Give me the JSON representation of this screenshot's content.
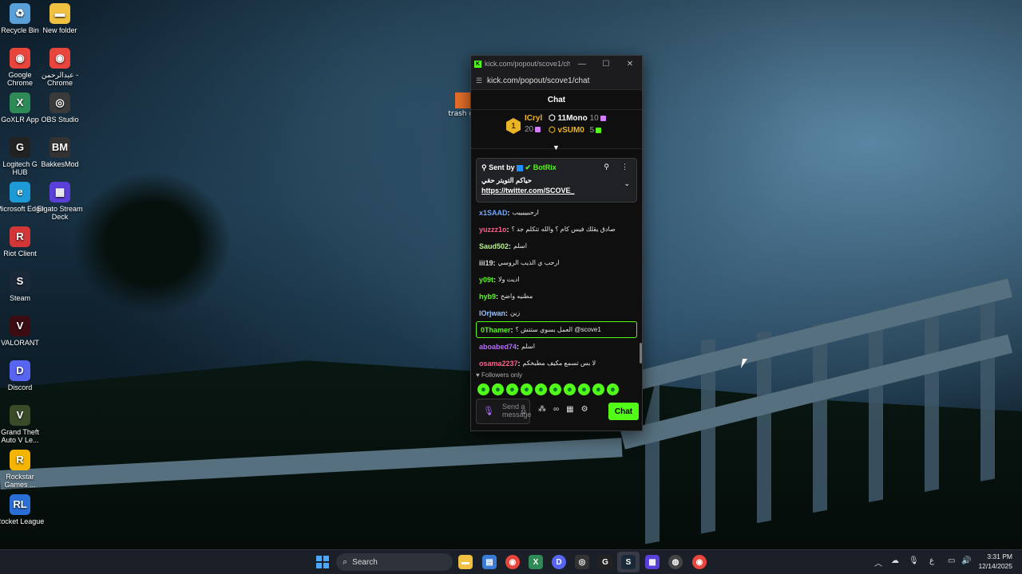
{
  "desktop": {
    "icons": [
      {
        "label": "Recycle Bin",
        "color": "#5aa0d8",
        "glyph": "♻"
      },
      {
        "label": "New folder",
        "color": "#f0c040",
        "glyph": "▬"
      },
      {
        "label": "Google Chrome",
        "color": "#e8453c",
        "glyph": "◉"
      },
      {
        "label": "عبدالرحمن - Chrome",
        "color": "#e8453c",
        "glyph": "◉"
      },
      {
        "label": "GoXLR App",
        "color": "#2e8b57",
        "glyph": "X"
      },
      {
        "label": "OBS Studio",
        "color": "#3a3a3a",
        "glyph": "◎"
      },
      {
        "label": "Logitech G HUB",
        "color": "#222222",
        "glyph": "G"
      },
      {
        "label": "BakkesMod",
        "color": "#333333",
        "glyph": "BM"
      },
      {
        "label": "Microsoft Edge",
        "color": "#1e9bd7",
        "glyph": "e"
      },
      {
        "label": "Elgato Stream Deck",
        "color": "#5b3fd9",
        "glyph": "▦"
      },
      {
        "label": "Riot Client",
        "color": "#d13639",
        "glyph": "R"
      },
      {
        "label": "Steam",
        "color": "#1b2838",
        "glyph": "S"
      },
      {
        "label": "VALORANT",
        "color": "#3b0d12",
        "glyph": "V"
      },
      {
        "label": "Discord",
        "color": "#5865f2",
        "glyph": "D"
      },
      {
        "label": "Grand Theft Auto V Le...",
        "color": "#3a4b2a",
        "glyph": "V"
      },
      {
        "label": "Rockstar Games ...",
        "color": "#f4b400",
        "glyph": "R"
      },
      {
        "label": "Rocket League",
        "color": "#2a6fd6",
        "glyph": "RL"
      }
    ],
    "trash_label": "trash ga"
  },
  "window": {
    "title": "kick.com/popout/scove1/ch...",
    "url": "kick.com/popout/scove1/chat",
    "chat_header": "Chat",
    "leaderboard": {
      "first": {
        "rank": "1",
        "name": "ICryl",
        "count": "20"
      },
      "second": {
        "name": "11Mono",
        "count": "10"
      },
      "third": {
        "name": "vSUM0",
        "count": "5"
      }
    },
    "pinned": {
      "sent_by": "Sent by",
      "bot": "BotRix",
      "text": "حياكم التويتر حقي",
      "link": "https://twitter.com/SCOVE_"
    },
    "messages": [
      {
        "user": "x1SAAD",
        "text": "ارحبيييييب",
        "color": "#6fa8ff"
      },
      {
        "user": "yuzzz1o",
        "text": "صادق يقلك فيس كام ؟ والله تتكلم جد ؟",
        "color": "#ff5f8a"
      },
      {
        "user": "Saud502",
        "text": "اسلم",
        "color": "#b9f28a"
      },
      {
        "user": "iii19",
        "text": "ارحب ي الذيب الروسي",
        "color": "#d8d8d8"
      },
      {
        "user": "y09t",
        "text": "اديت ولا",
        "color": "#53fc18"
      },
      {
        "user": "hyb9",
        "text": "مطنيه واضح",
        "color": "#53fc18"
      },
      {
        "user": "lOrjwan",
        "text": "زين",
        "color": "#9ec2ff"
      },
      {
        "user": "0Thamer",
        "text": "العمل بسوي ستتش ؟ @scove1",
        "color": "#53fc18",
        "highlight": true
      },
      {
        "user": "aboabed74",
        "text": "اسلم",
        "color": "#b66cff"
      },
      {
        "user": "osama2237",
        "text": "لا بس تسمع مكيف مطبخكم",
        "color": "#ff5f8a"
      }
    ],
    "followers_only": "Followers only",
    "composer_placeholder": "Send a message",
    "send_label": "Chat"
  },
  "taskbar": {
    "search_label": "Search",
    "lang": "ع",
    "time": "3:31 PM",
    "date": "12/14/2025"
  }
}
